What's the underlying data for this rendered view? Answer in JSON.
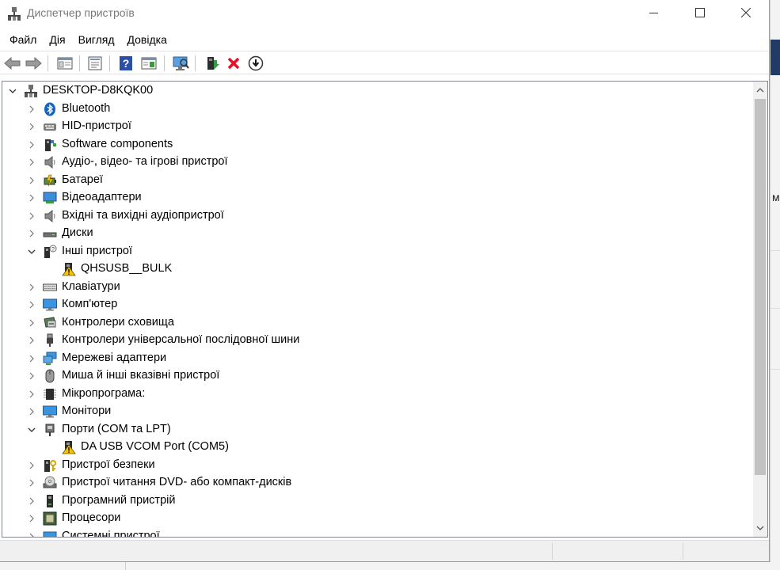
{
  "window": {
    "title": "Диспетчер пристроїв"
  },
  "menu": [
    "Файл",
    "Дія",
    "Вигляд",
    "Довідка"
  ],
  "toolbar": [
    "back",
    "forward",
    "show-hide-console-tree",
    "properties",
    "help",
    "action-pane",
    "scan-hardware",
    "update-driver",
    "uninstall-device",
    "disable-device"
  ],
  "background_app": {
    "letter": "м"
  },
  "tree": [
    {
      "level": 0,
      "expander": "expanded",
      "icon": "computer-icon",
      "label": "DESKTOP-D8KQK00"
    },
    {
      "level": 1,
      "expander": "collapsed",
      "icon": "bluetooth-icon",
      "label": "Bluetooth"
    },
    {
      "level": 1,
      "expander": "collapsed",
      "icon": "hid-icon",
      "label": "HID-пристрої"
    },
    {
      "level": 1,
      "expander": "collapsed",
      "icon": "software-components-icon",
      "label": "Software components"
    },
    {
      "level": 1,
      "expander": "collapsed",
      "icon": "speaker-icon",
      "label": "Аудіо-, відео- та ігрові пристрої"
    },
    {
      "level": 1,
      "expander": "collapsed",
      "icon": "battery-icon",
      "label": "Батареї"
    },
    {
      "level": 1,
      "expander": "collapsed",
      "icon": "display-adapter-icon",
      "label": "Відеоадаптери"
    },
    {
      "level": 1,
      "expander": "collapsed",
      "icon": "speaker-icon",
      "label": "Вхідні та вихідні аудіопристрої"
    },
    {
      "level": 1,
      "expander": "collapsed",
      "icon": "disk-icon",
      "label": "Диски"
    },
    {
      "level": 1,
      "expander": "expanded",
      "icon": "unknown-device-icon",
      "label": "Інші пристрої"
    },
    {
      "level": 2,
      "expander": "none",
      "icon": "warning-device-icon",
      "label": "QHSUSB__BULK"
    },
    {
      "level": 1,
      "expander": "collapsed",
      "icon": "keyboard-icon",
      "label": "Клавіатури"
    },
    {
      "level": 1,
      "expander": "collapsed",
      "icon": "monitor-icon",
      "label": "Комп'ютер"
    },
    {
      "level": 1,
      "expander": "collapsed",
      "icon": "storage-controller-icon",
      "label": "Контролери сховища"
    },
    {
      "level": 1,
      "expander": "collapsed",
      "icon": "usb-icon",
      "label": "Контролери універсальної послідовної шини"
    },
    {
      "level": 1,
      "expander": "collapsed",
      "icon": "network-icon",
      "label": "Мережеві адаптери"
    },
    {
      "level": 1,
      "expander": "collapsed",
      "icon": "mouse-icon",
      "label": "Миша й інші вказівні пристрої"
    },
    {
      "level": 1,
      "expander": "collapsed",
      "icon": "firmware-icon",
      "label": "Мікропрограма:"
    },
    {
      "level": 1,
      "expander": "collapsed",
      "icon": "monitor-icon",
      "label": "Монітори"
    },
    {
      "level": 1,
      "expander": "expanded",
      "icon": "port-icon",
      "label": "Порти (COM та LPT)"
    },
    {
      "level": 2,
      "expander": "none",
      "icon": "warning-device-icon",
      "label": "DA USB VCOM Port (COM5)"
    },
    {
      "level": 1,
      "expander": "collapsed",
      "icon": "security-device-icon",
      "label": "Пристрої безпеки"
    },
    {
      "level": 1,
      "expander": "collapsed",
      "icon": "dvd-icon",
      "label": "Пристрої читання DVD- або компакт-дисків"
    },
    {
      "level": 1,
      "expander": "collapsed",
      "icon": "software-device-icon",
      "label": "Програмний пристрій"
    },
    {
      "level": 1,
      "expander": "collapsed",
      "icon": "processor-icon",
      "label": "Процесори"
    },
    {
      "level": 1,
      "expander": "collapsed",
      "icon": "system-device-icon",
      "label": "Системні пристрої"
    }
  ],
  "colors": {
    "accent": "#0078d7",
    "warning": "#f5c400",
    "error_x": "#e81123"
  }
}
